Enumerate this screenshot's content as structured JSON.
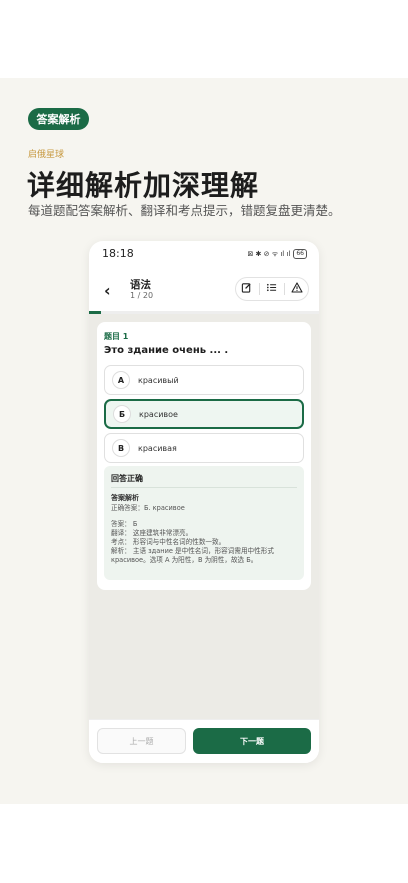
{
  "promo": {
    "tag": "答案解析",
    "brand": "启俄星球",
    "headline": "详细解析加深理解",
    "subline": "每道题配答案解析、翻译和考点提示，错题复盘更清楚。"
  },
  "status_bar": {
    "time": "18:18",
    "icons": "⊠ ✱ ⊘ ᯤ ıl ıl",
    "battery": "66"
  },
  "app_bar": {
    "title": "语法",
    "progress_text": "1 / 20",
    "progress_fraction": 0.05
  },
  "question": {
    "number": "题目 1",
    "text": "Это здание очень ... .",
    "options": [
      {
        "letter": "А",
        "text": "красивый",
        "selected": false
      },
      {
        "letter": "Б",
        "text": "красивое",
        "selected": true
      },
      {
        "letter": "В",
        "text": "красивая",
        "selected": false
      }
    ]
  },
  "explanation": {
    "status": "回答正确",
    "title": "答案解析",
    "correct": "正确答案：Б. красивое",
    "answer": "答案：  Б",
    "translation": "翻译：  这座建筑非常漂亮。",
    "point": "考点：  形容词与中性名词的性数一致。",
    "analysis": "解析：  主语 здание 是中性名词，形容词需用中性形式 красивое。选项 A 为阳性，B 为阴性，故选 Б。"
  },
  "buttons": {
    "prev": "上一题",
    "next": "下一题"
  },
  "colors": {
    "accent": "#1b6b46",
    "brand": "#c89a42"
  }
}
